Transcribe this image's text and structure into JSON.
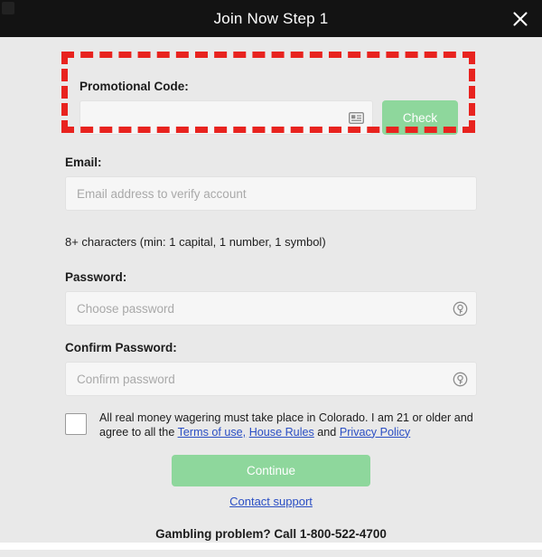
{
  "header": {
    "title": "Join Now Step 1",
    "close_icon": "close-icon"
  },
  "promo": {
    "label": "Promotional Code:",
    "value": "",
    "placeholder": "",
    "input_icon": "contact-card-icon",
    "check_label": "Check"
  },
  "email": {
    "label": "Email:",
    "value": "",
    "placeholder": "Email address to verify account"
  },
  "password_hint": "8+ characters (min: 1 capital, 1 number, 1 symbol)",
  "password": {
    "label": "Password:",
    "value": "",
    "placeholder": "Choose password",
    "input_icon": "key-icon"
  },
  "confirm_password": {
    "label": "Confirm Password:",
    "value": "",
    "placeholder": "Confirm password",
    "input_icon": "key-icon"
  },
  "terms": {
    "checked": false,
    "text_part1": "All real money wagering must take place in Colorado. I am 21 or older and agree to all the ",
    "link_terms": "Terms of use,",
    "separator1": " ",
    "link_house_rules": "House Rules",
    "separator2": " and ",
    "link_privacy": "Privacy Policy"
  },
  "actions": {
    "continue_label": "Continue",
    "contact_support_label": "Contact support"
  },
  "footer": {
    "gambling_note": "Gambling problem? Call 1-800-522-4700"
  },
  "colors": {
    "header_bg": "#131313",
    "page_bg": "#e9e9e9",
    "button_green": "#8ed79c",
    "link_blue": "#2b4fc4",
    "highlight_red": "#e8231f",
    "input_bg": "#f6f6f6"
  }
}
